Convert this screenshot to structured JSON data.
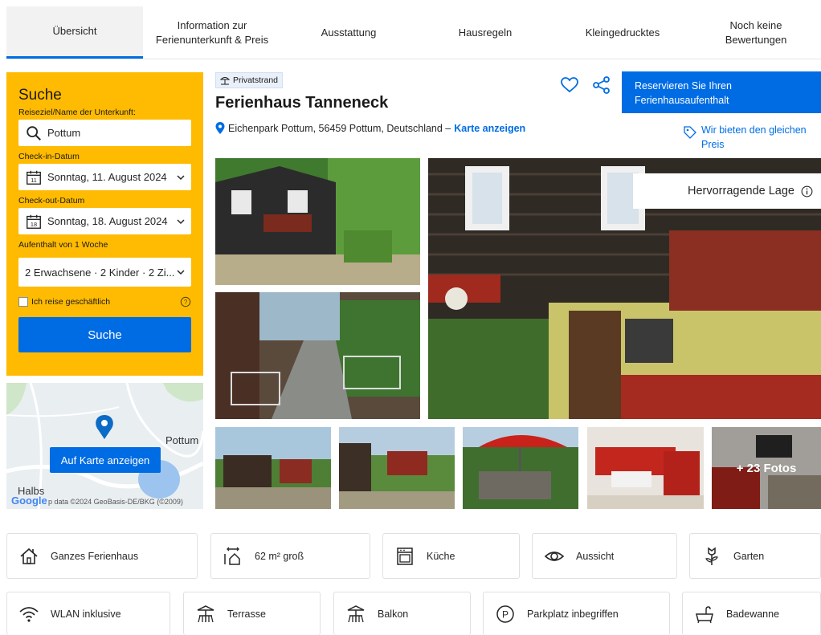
{
  "tabs": [
    {
      "label": "Übersicht",
      "active": true
    },
    {
      "label": "Information zur\nFerienunterkunft & Preis"
    },
    {
      "label": "Ausstattung"
    },
    {
      "label": "Hausregeln"
    },
    {
      "label": "Kleingedrucktes"
    },
    {
      "label": "Noch keine\nBewertungen"
    }
  ],
  "search": {
    "title": "Suche",
    "destination_label": "Reiseziel/Name der Unterkunft:",
    "destination_value": "Pottum",
    "checkin_label": "Check-in-Datum",
    "checkin_value": "Sonntag, 11. August 2024",
    "checkin_day": "11",
    "checkout_label": "Check-out-Datum",
    "checkout_value": "Sonntag, 18. August 2024",
    "checkout_day": "18",
    "stay_label": "Aufenthalt von 1 Woche",
    "guests_value": "2 Erwachsene · 2 Kinder · 2 Zi...",
    "business_label": "Ich reise geschäftlich",
    "button_label": "Suche"
  },
  "map": {
    "button_label": "Auf Karte anzeigen",
    "place_pottum": "Pottum",
    "place_halbs": "Halbs",
    "google": "Google",
    "copyright": "p data ©2024 GeoBasis-DE/BKG (©2009)"
  },
  "property": {
    "badge": "Privatstrand",
    "name": "Ferienhaus Tanneneck",
    "address": "Eichenpark Pottum, 56459 Pottum, Deutschland –",
    "map_link": "Karte anzeigen",
    "reserve_label": "Reservieren Sie Ihren Ferienhausaufenthalt",
    "price_match": "Wir bieten den gleichen Preis",
    "highlight": "Hervorragende Lage",
    "more_photos": "+ 23 Fotos"
  },
  "facilities_row1": [
    {
      "label": "Ganzes Ferienhaus",
      "icon": "house-icon"
    },
    {
      "label": "62 m² groß",
      "icon": "size-icon"
    },
    {
      "label": "Küche",
      "icon": "kitchen-icon"
    },
    {
      "label": "Aussicht",
      "icon": "eye-icon"
    },
    {
      "label": "Garten",
      "icon": "flower-icon"
    }
  ],
  "facilities_row2": [
    {
      "label": "WLAN inklusive",
      "icon": "wifi-icon"
    },
    {
      "label": "Terrasse",
      "icon": "terrace-icon"
    },
    {
      "label": "Balkon",
      "icon": "balcony-icon"
    },
    {
      "label": "Parkplatz inbegriffen",
      "icon": "parking-icon"
    },
    {
      "label": "Badewanne",
      "icon": "bathtub-icon"
    }
  ],
  "colors": {
    "brand_blue": "#006ce4",
    "search_yellow": "#febb02"
  }
}
